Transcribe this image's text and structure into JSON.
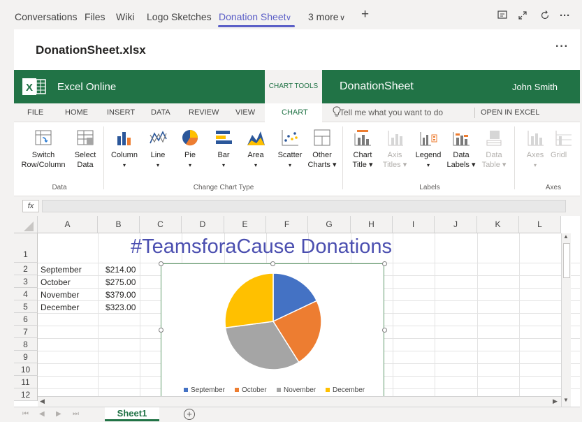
{
  "teams_tabs": {
    "items": [
      {
        "label": "Conversations",
        "dropdown": false
      },
      {
        "label": "Files",
        "dropdown": false
      },
      {
        "label": "Wiki",
        "dropdown": false
      },
      {
        "label": "Logo Sketches",
        "dropdown": false
      },
      {
        "label": "Donation Sheet",
        "dropdown": true
      },
      {
        "label": "3 more",
        "dropdown": true
      }
    ],
    "active": "Donation Sheet",
    "add": "+"
  },
  "file": {
    "title": "DonationSheet.xlsx",
    "more": "···"
  },
  "app": {
    "name": "Excel Online",
    "context": "CHART TOOLS",
    "document": "DonationSheet",
    "user": "John Smith"
  },
  "menu": {
    "tabs": [
      "FILE",
      "HOME",
      "INSERT",
      "DATA",
      "REVIEW",
      "VIEW",
      "CHART"
    ],
    "active": "CHART",
    "tell_me_placeholder": "Tell me what you want to do",
    "open_in": "OPEN IN EXCEL"
  },
  "ribbon": {
    "data": {
      "switch_line1": "Switch",
      "switch_line2": "Row/Column",
      "select_line1": "Select",
      "select_line2": "Data",
      "group": "Data"
    },
    "chart_type": {
      "column": "Column",
      "line": "Line",
      "pie": "Pie",
      "bar": "Bar",
      "area": "Area",
      "scatter": "Scatter",
      "other_line1": "Other",
      "other_line2": "Charts ▾",
      "group": "Change Chart Type"
    },
    "labels": {
      "chart_title_line1": "Chart",
      "chart_title_line2": "Title ▾",
      "axis_titles_line1": "Axis",
      "axis_titles_line2": "Titles ▾",
      "legend": "Legend",
      "data_labels_line1": "Data",
      "data_labels_line2": "Labels ▾",
      "data_table_line1": "Data",
      "data_table_line2": "Table ▾",
      "group": "Labels"
    },
    "axes": {
      "axes": "Axes",
      "gridlines": "Gridl",
      "group": "Axes"
    }
  },
  "formula": {
    "fx": "fx",
    "value": ""
  },
  "grid": {
    "columns": [
      "A",
      "B",
      "C",
      "D",
      "E",
      "F",
      "G",
      "H",
      "I",
      "J",
      "K",
      "L"
    ],
    "rows": [
      "1",
      "2",
      "3",
      "4",
      "5",
      "6",
      "7",
      "8",
      "9",
      "10",
      "11",
      "12"
    ],
    "title": "#TeamsforaCause Donations",
    "data": [
      {
        "month": "September",
        "amount": "$214.00"
      },
      {
        "month": "October",
        "amount": "$275.00"
      },
      {
        "month": "November",
        "amount": "$379.00"
      },
      {
        "month": "December",
        "amount": "$323.00"
      }
    ]
  },
  "chart_data": {
    "type": "pie",
    "categories": [
      "September",
      "October",
      "November",
      "December"
    ],
    "values": [
      214,
      275,
      379,
      323
    ],
    "colors": [
      "#4472c4",
      "#ed7d31",
      "#a5a5a5",
      "#ffc000"
    ],
    "legend": "bottom",
    "title": ""
  },
  "sheets": {
    "tabs": [
      "Sheet1"
    ],
    "active": "Sheet1",
    "add": "+"
  }
}
